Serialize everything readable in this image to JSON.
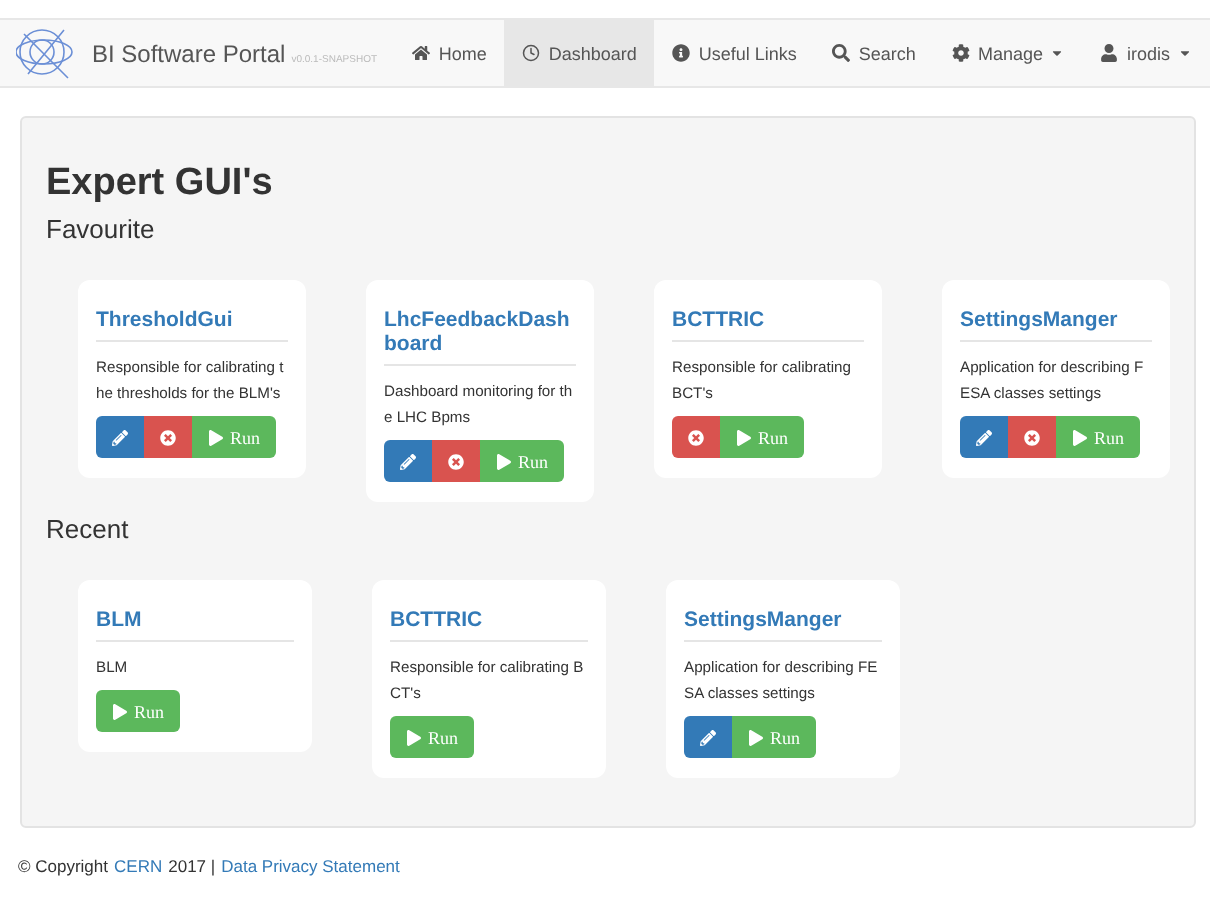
{
  "navbar": {
    "brand": "BI Software Portal",
    "version": "v0.0.1-SNAPSHOT",
    "items": [
      {
        "label": "Home",
        "selected": false,
        "dropdown": false
      },
      {
        "label": "Dashboard",
        "selected": true,
        "dropdown": false
      },
      {
        "label": "Useful Links",
        "selected": false,
        "dropdown": false
      },
      {
        "label": "Search",
        "selected": false,
        "dropdown": false
      },
      {
        "label": "Manage",
        "selected": false,
        "dropdown": true
      },
      {
        "label": "irodis",
        "selected": false,
        "dropdown": true
      }
    ]
  },
  "heading": "Expert GUI's",
  "sections": [
    {
      "title": "Favourite",
      "apps": [
        {
          "name": "ThresholdGui",
          "description": "Responsible for calibrating the thresholds for the BLM's",
          "editable": true,
          "removable": true,
          "run": "Run"
        },
        {
          "name": "LhcFeedbackDashboard",
          "description": "Dashboard monitoring for the LHC Bpms",
          "editable": true,
          "removable": true,
          "run": "Run"
        },
        {
          "name": "BCTTRIC",
          "description": "Responsible for calibrating BCT's",
          "editable": false,
          "removable": true,
          "run": "Run"
        },
        {
          "name": "SettingsManger",
          "description": "Application for describing FESA classes settings",
          "editable": true,
          "removable": true,
          "run": "Run"
        }
      ]
    },
    {
      "title": "Recent",
      "apps": [
        {
          "name": "BLM",
          "description": "BLM",
          "editable": false,
          "removable": false,
          "run": "Run"
        },
        {
          "name": "BCTTRIC",
          "description": "Responsible for calibrating BCT's",
          "editable": false,
          "removable": false,
          "run": "Run"
        },
        {
          "name": "SettingsManger",
          "description": "Application for describing FESA classes settings",
          "editable": true,
          "removable": false,
          "run": "Run"
        }
      ]
    }
  ],
  "footer": {
    "copyright": "© Copyright",
    "org_link": "CERN",
    "year": "2017 |",
    "privacy_link": "Data Privacy Statement"
  }
}
